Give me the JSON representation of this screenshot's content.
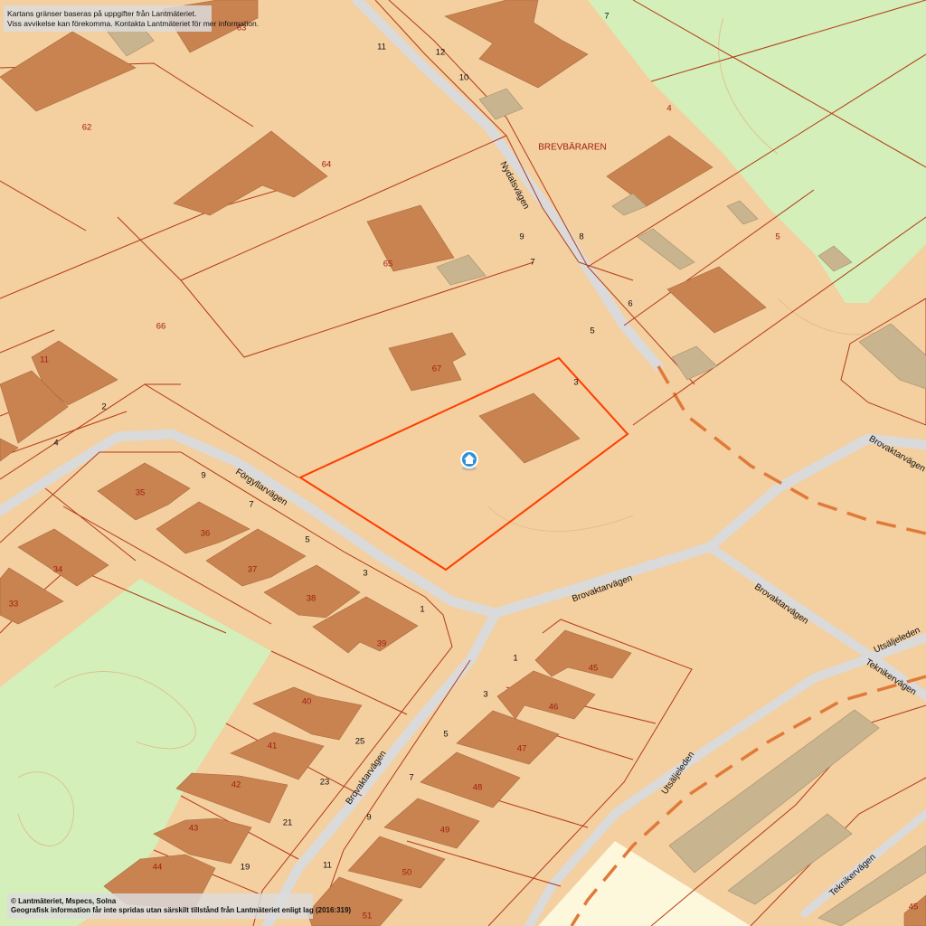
{
  "notice_top": {
    "line1": "Kartans gränser baseras på uppgifter från Lantmäteriet.",
    "line2": "Viss avvikelse kan förekomma. Kontakta Lantmäteriet för mer information."
  },
  "notice_bottom": {
    "line1": "© Lantmäteriet, Mspecs, Solna",
    "line2": "Geografisk information får inte spridas utan särskilt tillstånd från Lantmäteriet enligt lag (2016:319)"
  },
  "colors": {
    "land": "#f4cf9f",
    "building": "#c98350",
    "outbuilding": "#c8b48e",
    "green": "#d4efb9",
    "road": "#dadada",
    "boundary": "#b33a17",
    "selected_boundary": "#ff3d00",
    "planned_road": "#e07a3a"
  },
  "marker": {
    "icon": "home-marker-icon"
  },
  "district": "BREVBÄRAREN",
  "streets": {
    "nydalsvagen": "Nydalsvägen",
    "forgyllarvagen": "Förgyllarvägen",
    "brovaktarvagen_1": "Brovaktarvägen",
    "brovaktarvagen_2": "Brovaktarvägen",
    "brovaktarvagen_3": "Brovaktarvägen",
    "brovaktarvagen_4": "Brovaktarvägen",
    "utsaljeleden_1": "Utsäljeleden",
    "utsaljeleden_2": "Utsäljeleden",
    "teknikervagen_1": "Teknikervägen",
    "teknikervagen_2": "Teknikervägen"
  },
  "parcels": {
    "p63": "63",
    "p62": "62",
    "p64": "64",
    "p65": "65",
    "p66": "66",
    "p67": "67",
    "p4": "4",
    "p5": "5",
    "p11": "11",
    "p35": "35",
    "p36": "36",
    "p37": "37",
    "p38": "38",
    "p39": "39",
    "p34": "34",
    "p33": "33",
    "p40": "40",
    "p41": "41",
    "p42": "42",
    "p43": "43",
    "p44": "44",
    "p45": "45",
    "p46": "46",
    "p47": "47",
    "p48": "48",
    "p49": "49",
    "p50": "50",
    "p51": "51",
    "p45b": "45"
  },
  "addresses": {
    "a7top": "7",
    "a11": "11",
    "a12": "12",
    "a10": "10",
    "a9n": "9",
    "a8n": "8",
    "a7n": "7",
    "a6n": "6",
    "a5n": "5",
    "a3n": "3",
    "a2": "2",
    "a4": "4",
    "a9f": "9",
    "a7f": "7",
    "a5f": "5",
    "a3f": "3",
    "a1f": "1",
    "a25": "25",
    "a23": "23",
    "a21": "21",
    "a19": "19",
    "a1b": "1",
    "a3b": "3",
    "a5b": "5",
    "a7b": "7",
    "a9b": "9",
    "a11b": "11"
  }
}
